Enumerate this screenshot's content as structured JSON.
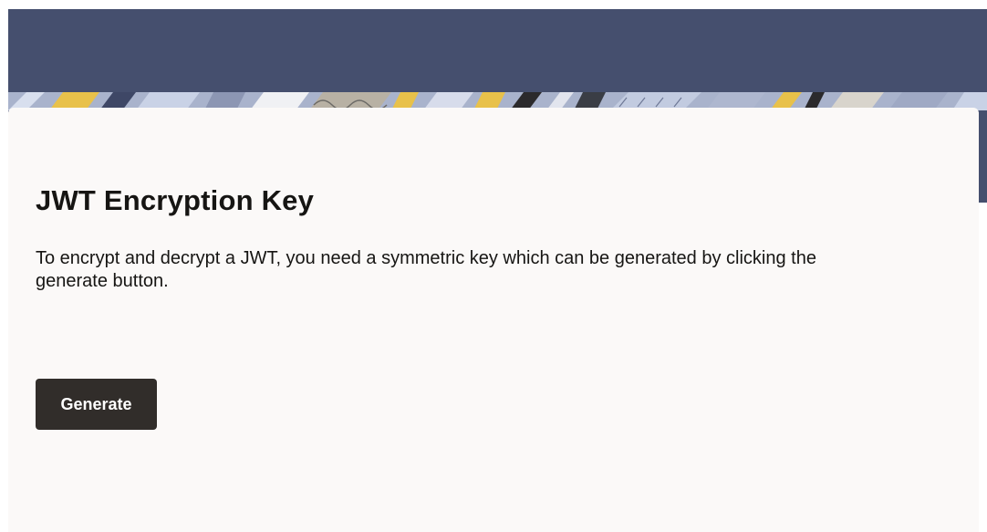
{
  "card": {
    "title": "JWT Encryption Key",
    "description": "To encrypt and decrypt a JWT, you need a symmetric key which can be generated by clicking the generate button.",
    "generate_label": "Generate"
  },
  "colors": {
    "header_band": "#454f6e",
    "card_background": "#fbf9f8",
    "primary_button": "#312d2a",
    "text": "#161513"
  }
}
